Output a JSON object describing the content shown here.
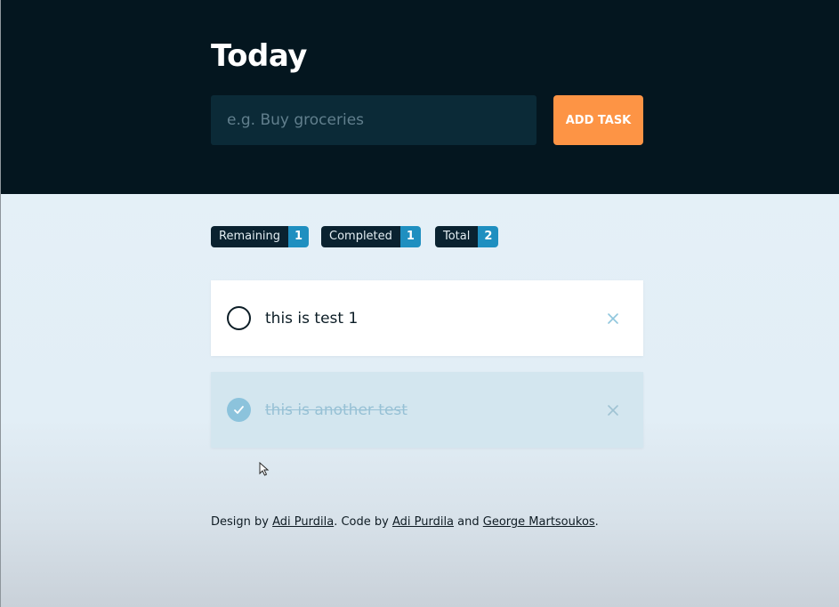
{
  "header": {
    "title": "Today",
    "input_placeholder": "e.g. Buy groceries",
    "add_button_label": "ADD TASK"
  },
  "stats": [
    {
      "label": "Remaining",
      "count": "1"
    },
    {
      "label": "Completed",
      "count": "1"
    },
    {
      "label": "Total",
      "count": "2"
    }
  ],
  "tasks": [
    {
      "text": "this is test 1",
      "completed": false
    },
    {
      "text": "this is another test",
      "completed": true
    }
  ],
  "icons": {
    "checkbox_empty": "circle-icon",
    "checkbox_checked": "check-circle-icon",
    "delete": "close-icon"
  },
  "footer": {
    "design_prefix": "Design by ",
    "designer": "Adi Purdila",
    "code_prefix": ". Code by ",
    "coder1": "Adi Purdila",
    "and_text": " and ",
    "coder2": "George Martsoukos",
    "suffix": "."
  },
  "colors": {
    "header_bg": "#04161f",
    "accent": "#fd9445",
    "badge_count": "#1f8fc0",
    "badge_label": "#0a2230"
  }
}
